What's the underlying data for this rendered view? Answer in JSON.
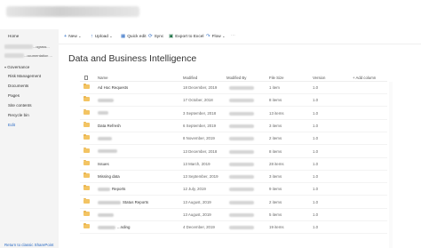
{
  "sidebar": {
    "items": [
      {
        "label": "Home"
      },
      {
        "label": "...ograss..."
      },
      {
        "label": "...ocumentation ..."
      },
      {
        "label": "Governance"
      },
      {
        "label": "Risk Management"
      },
      {
        "label": "Documents"
      },
      {
        "label": "Pages"
      },
      {
        "label": "Site contents"
      },
      {
        "label": "Recycle bin"
      },
      {
        "label": "Edit"
      }
    ],
    "return_link": "Return to classic SharePoint"
  },
  "toolbar": {
    "new": "New",
    "upload": "Upload",
    "quick_edit": "Quick edit",
    "sync": "Sync",
    "export": "Export to Excel",
    "flow": "Flow",
    "more": "···",
    "icons": {
      "new": "plus-icon",
      "upload": "upload-icon",
      "quick_edit": "grid-icon",
      "sync": "sync-icon",
      "export": "excel-icon",
      "flow": "flow-icon"
    }
  },
  "page": {
    "title": "Data and Business Intelligence"
  },
  "table": {
    "headers": {
      "name": "Name",
      "modified": "Modified",
      "modified_by": "Modified By",
      "file_size": "File Size",
      "version": "Version",
      "add_column": "+ Add column"
    },
    "rows": [
      {
        "name": "Ad Hoc Requests",
        "modified": "18 December, 2019",
        "size": "1 item",
        "version": "1.0"
      },
      {
        "name": "",
        "modified": "17 October, 2018",
        "size": "8 items",
        "version": "1.0"
      },
      {
        "name": "",
        "modified": "3 September, 2018",
        "size": "13 items",
        "version": "1.0"
      },
      {
        "name": "Data Refresh",
        "modified": "6 September, 2019",
        "size": "3 items",
        "version": "1.0"
      },
      {
        "name": "",
        "modified": "8 November, 2019",
        "size": "2 items",
        "version": "1.0"
      },
      {
        "name": "",
        "modified": "13 December, 2018",
        "size": "8 items",
        "version": "1.0"
      },
      {
        "name": "Issues",
        "modified": "13 March, 2019",
        "size": "28 items",
        "version": "1.0"
      },
      {
        "name": "Missing data",
        "modified": "13 September, 2019",
        "size": "3 items",
        "version": "1.0"
      },
      {
        "name": "Reports",
        "modified": "12 July, 2019",
        "size": "9 items",
        "version": "1.0"
      },
      {
        "name": "Status Reports",
        "modified": "13 August, 2019",
        "size": "2 items",
        "version": "1.0"
      },
      {
        "name": "",
        "modified": "13 August, 2019",
        "size": "5 items",
        "version": "1.0"
      },
      {
        "name": "...nding",
        "modified": "4 December, 2019",
        "size": "19 items",
        "version": "1.0"
      }
    ]
  }
}
